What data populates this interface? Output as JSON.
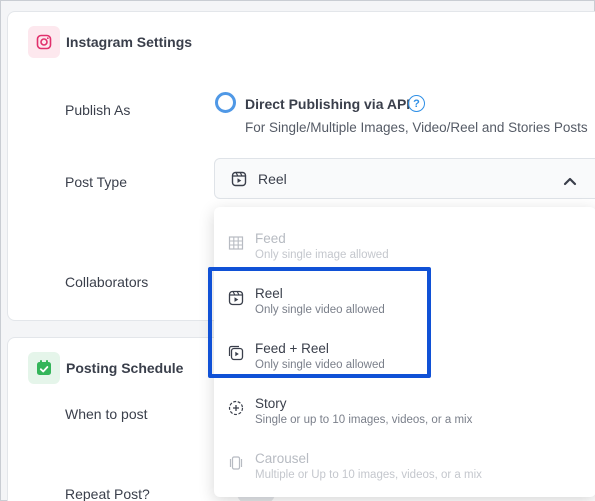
{
  "instagram": {
    "title": "Instagram Settings",
    "publish_as_label": "Publish As",
    "publish_option_title": "Direct Publishing via API",
    "publish_option_sub": "For Single/Multiple Images, Video/Reel and Stories Posts",
    "help_glyph": "?",
    "post_type_label": "Post Type",
    "post_type_value": "Reel",
    "collaborators_label": "Collaborators"
  },
  "posting_schedule": {
    "title": "Posting Schedule",
    "when_label": "When to post",
    "repeat_label": "Repeat Post?"
  },
  "dropdown": {
    "options": [
      {
        "title": "Feed",
        "sub": "Only single image allowed",
        "icon": "grid-icon",
        "enabled": false
      },
      {
        "title": "Reel",
        "sub": "Only single video allowed",
        "icon": "reel-icon",
        "enabled": true
      },
      {
        "title": "Feed + Reel",
        "sub": "Only single video allowed",
        "icon": "feed-reel-icon",
        "enabled": true
      },
      {
        "title": "Story",
        "sub": "Single or up to 10 images, videos, or a mix",
        "icon": "story-add-icon",
        "enabled": true
      },
      {
        "title": "Carousel",
        "sub": "Multiple or Up to 10 images, videos, or a mix",
        "icon": "carousel-icon",
        "enabled": false
      }
    ]
  },
  "colors": {
    "accent_blue": "#2e8fe6",
    "highlight": "#1051d6",
    "instagram_pink": "#e1306c",
    "schedule_green": "#34b55a"
  }
}
